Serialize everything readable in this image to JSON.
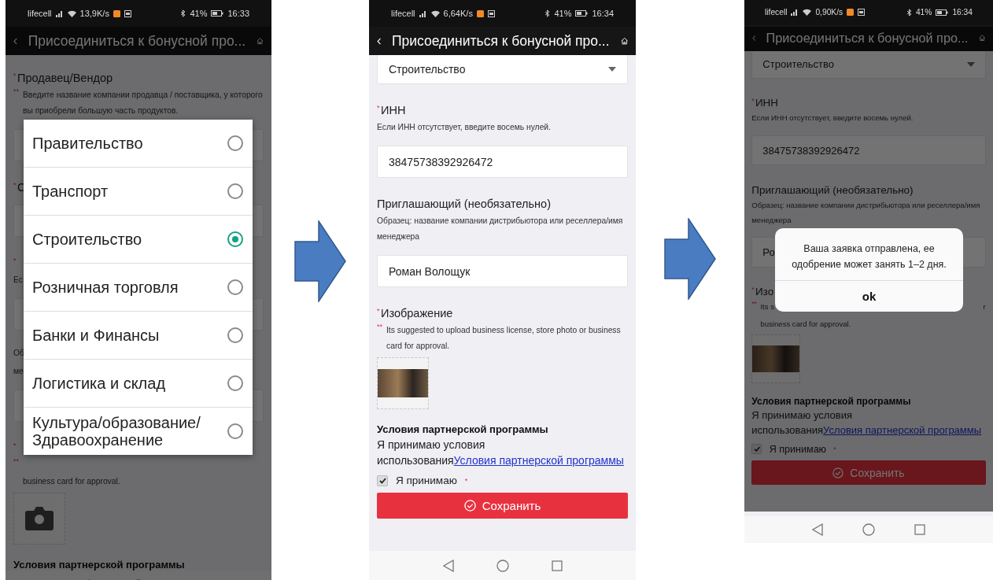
{
  "screens": [
    {
      "status_bar": {
        "carrier": "lifecell",
        "speed": "13,9K/s",
        "battery": "41%",
        "time": "16:33"
      },
      "title": "Присоединиться к бонусной про...",
      "form": [
        {
          "kind": "label",
          "text": "Продавец/Вендор",
          "marker": "*"
        },
        {
          "kind": "hint",
          "marker": "**",
          "text": "Введите название компании продавца / поставщика, у которого вы приобрели большую часть продуктов."
        },
        {
          "kind": "input"
        },
        {
          "kind": "label",
          "text": "С",
          "marker": "*"
        },
        {
          "kind": "select"
        },
        {
          "kind": "label",
          "marker": "*"
        },
        {
          "kind": "hint",
          "text": "Ес"
        },
        {
          "kind": "input"
        },
        {
          "kind": "hint",
          "text": "Об"
        },
        {
          "kind": "hint",
          "text": "ме"
        },
        {
          "kind": "input"
        },
        {
          "kind": "label",
          "marker": "*"
        },
        {
          "kind": "hint",
          "marker": "**"
        },
        {
          "kind": "hint",
          "text": "business card for approval.",
          "indent": true
        },
        {
          "kind": "image",
          "photo": false
        },
        {
          "kind": "heading",
          "text": "Условия партнерской программы"
        }
      ],
      "overlay": {
        "kind": "picker",
        "options": [
          {
            "label": "Правительство",
            "selected": false
          },
          {
            "label": "Транспорт",
            "selected": false
          },
          {
            "label": "Строительство",
            "selected": true
          },
          {
            "label": "Розничная торговля",
            "selected": false
          },
          {
            "label": "Банки и Финансы",
            "selected": false
          },
          {
            "label": "Логистика и склад",
            "selected": false
          },
          {
            "label": "Культура/образование/ Здравоохранение",
            "selected": false
          }
        ]
      }
    },
    {
      "status_bar": {
        "carrier": "lifecell",
        "speed": "6,64K/s",
        "battery": "41%",
        "time": "16:34"
      },
      "title": "Присоединиться к бонусной про...",
      "form": [
        {
          "kind": "select",
          "value": "Строительство"
        },
        {
          "kind": "label",
          "text": "ИНН",
          "marker": "*"
        },
        {
          "kind": "hint",
          "text": "Если ИНН отсутствует, введите восемь нулей."
        },
        {
          "kind": "input",
          "value": "38475738392926472"
        },
        {
          "kind": "label",
          "text": "Приглашающий (необязательно)"
        },
        {
          "kind": "hint",
          "text": "Образец: название компании дистрибьютора или реселлера/имя менеджера"
        },
        {
          "kind": "input",
          "value": "Роман Волощук"
        },
        {
          "kind": "label",
          "text": "Изображение",
          "marker": "*"
        },
        {
          "kind": "hint",
          "marker": "**",
          "text": "Its suggested to upload business license, store photo or business card for approval."
        },
        {
          "kind": "image",
          "photo": true
        },
        {
          "kind": "heading",
          "text": "Условия партнерской программы"
        },
        {
          "kind": "terms",
          "text": "Я принимаю условия использования",
          "link": "Условия партнерской программы"
        },
        {
          "kind": "checkbox",
          "label": "Я принимаю",
          "checked": true,
          "marker": "*"
        },
        {
          "kind": "button",
          "label": "Сохранить"
        }
      ]
    },
    {
      "status_bar": {
        "carrier": "lifecell",
        "speed": "0,90K/s",
        "battery": "41%",
        "time": "16:34"
      },
      "title": "Присоединиться к бонусной про...",
      "form": [
        {
          "kind": "select",
          "value": "Строительство"
        },
        {
          "kind": "label",
          "text": "ИНН",
          "marker": "*"
        },
        {
          "kind": "hint",
          "text": "Если ИНН отсутствует, введите восемь нулей."
        },
        {
          "kind": "input",
          "value": "38475738392926472"
        },
        {
          "kind": "label",
          "text": "Приглашающий (необязательно)"
        },
        {
          "kind": "hint",
          "text": "Образец: название компании дистрибьютора или реселлера/имя менеджера"
        },
        {
          "kind": "input",
          "value": "Ро"
        },
        {
          "kind": "label",
          "text": "Изо",
          "marker": "*"
        },
        {
          "kind": "hint",
          "marker": "**",
          "text": "Its s",
          "tail": "r"
        },
        {
          "kind": "hint",
          "text": "business card for approval.",
          "indent": true
        },
        {
          "kind": "image",
          "photo": true
        },
        {
          "kind": "heading",
          "text": "Условия партнерской программы"
        },
        {
          "kind": "terms",
          "text": "Я принимаю условия использования",
          "link": "Условия партнерской программы"
        },
        {
          "kind": "checkbox",
          "label": "Я принимаю",
          "checked": true,
          "marker": "*"
        },
        {
          "kind": "button",
          "label": "Сохранить"
        }
      ],
      "overlay": {
        "kind": "dialog",
        "message": "Ваша заявка отправлена, ее одобрение может занять 1–2 дня.",
        "button": "ok"
      }
    }
  ]
}
